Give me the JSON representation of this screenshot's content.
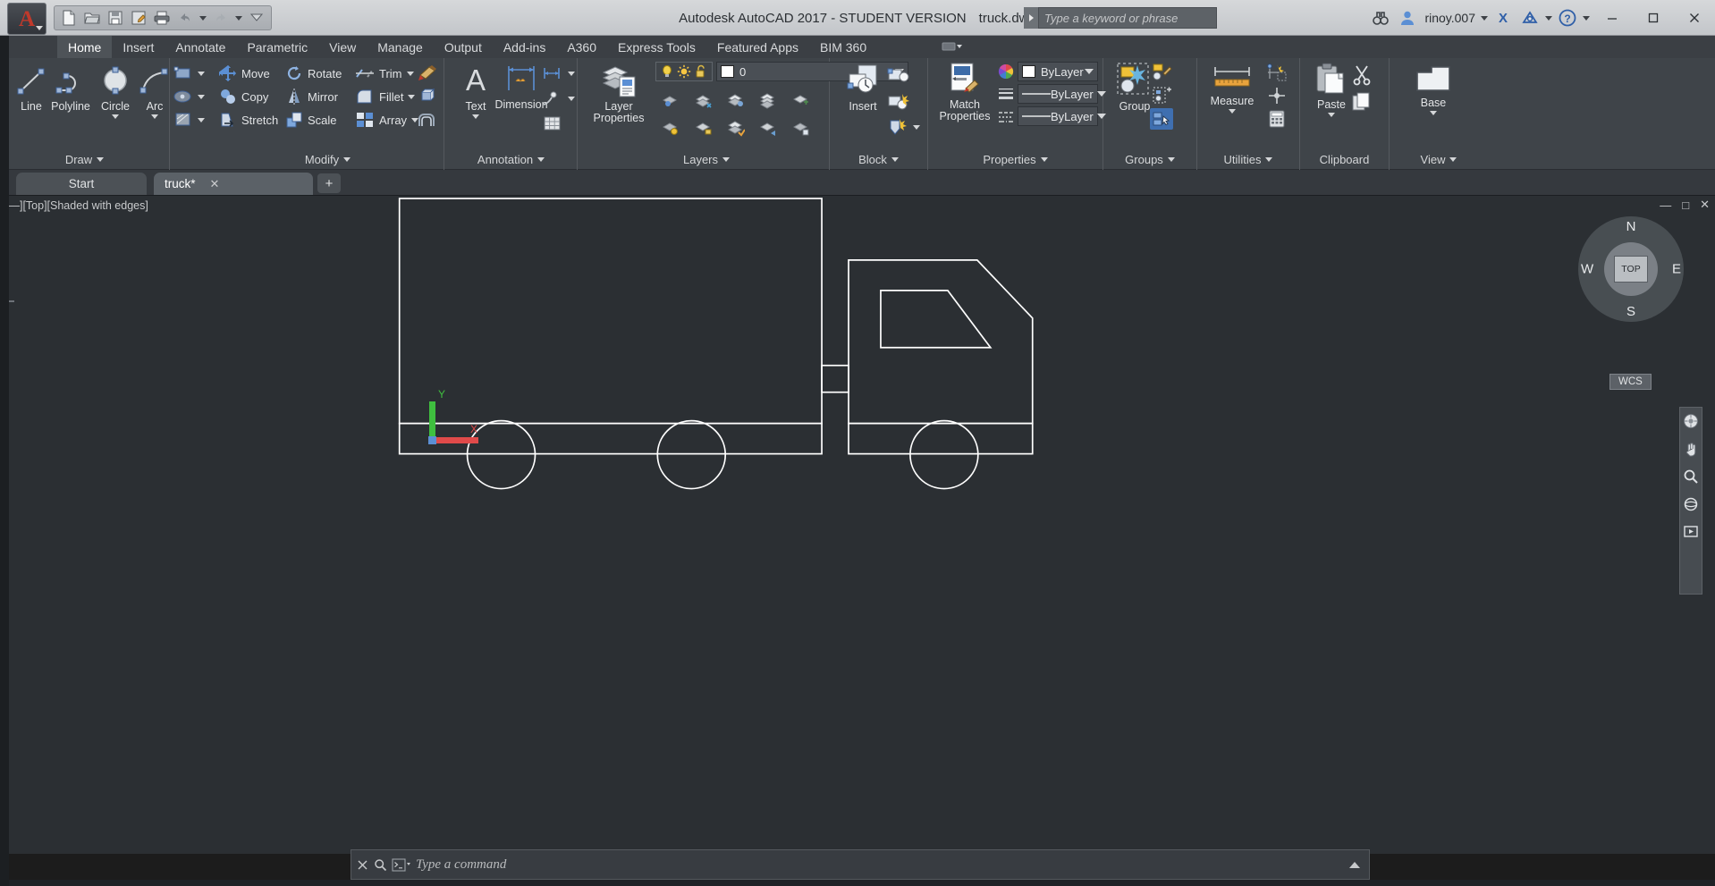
{
  "titlebar": {
    "app_name": "Autodesk AutoCAD 2017 - STUDENT VERSION",
    "file_name": "truck.dwg",
    "app_letter": "A",
    "quick_access": [
      {
        "name": "new-icon",
        "label": "New"
      },
      {
        "name": "open-icon",
        "label": "Open"
      },
      {
        "name": "save-icon",
        "label": "Save"
      },
      {
        "name": "saveas-icon",
        "label": "Save As"
      },
      {
        "name": "plot-icon",
        "label": "Plot"
      },
      {
        "name": "undo-icon",
        "label": "Undo"
      },
      {
        "name": "redo-icon",
        "label": "Redo"
      },
      {
        "name": "customize-icon",
        "label": "Customize Quick Access Toolbar"
      }
    ],
    "search_placeholder": "Type a keyword or phrase",
    "search_value": "",
    "user_name": "rinoy.007",
    "minimize": "—",
    "maximize": "□",
    "close": "✕",
    "help": "?"
  },
  "ribbon_tabs": [
    {
      "label": "Home",
      "active": true
    },
    {
      "label": "Insert",
      "active": false
    },
    {
      "label": "Annotate",
      "active": false
    },
    {
      "label": "Parametric",
      "active": false
    },
    {
      "label": "View",
      "active": false
    },
    {
      "label": "Manage",
      "active": false
    },
    {
      "label": "Output",
      "active": false
    },
    {
      "label": "Add-ins",
      "active": false
    },
    {
      "label": "A360",
      "active": false
    },
    {
      "label": "Express Tools",
      "active": false
    },
    {
      "label": "Featured Apps",
      "active": false
    },
    {
      "label": "BIM 360",
      "active": false
    }
  ],
  "panels": {
    "draw": {
      "title": "Draw",
      "buttons": [
        {
          "label": "Line",
          "icon": "line-icon"
        },
        {
          "label": "Polyline",
          "icon": "polyline-icon"
        },
        {
          "label": "Circle",
          "icon": "circle-icon"
        },
        {
          "label": "Arc",
          "icon": "arc-icon"
        }
      ],
      "flyouts": [
        {
          "icon": "rectangle-icon"
        },
        {
          "icon": "ellipse-icon"
        },
        {
          "icon": "hatch-icon"
        }
      ]
    },
    "modify": {
      "title": "Modify",
      "col1": [
        {
          "label": "Move",
          "icon": "move-icon"
        },
        {
          "label": "Copy",
          "icon": "copy-icon"
        },
        {
          "label": "Stretch",
          "icon": "stretch-icon"
        }
      ],
      "col2": [
        {
          "label": "Rotate",
          "icon": "rotate-icon"
        },
        {
          "label": "Mirror",
          "icon": "mirror-icon"
        },
        {
          "label": "Scale",
          "icon": "scale-icon"
        }
      ],
      "col3": [
        {
          "label": "Trim",
          "icon": "trim-icon"
        },
        {
          "label": "Fillet",
          "icon": "fillet-icon"
        },
        {
          "label": "Array",
          "icon": "array-icon"
        }
      ],
      "col4": [
        {
          "icon": "erase-icon"
        },
        {
          "icon": "explode-icon"
        },
        {
          "icon": "offset-icon"
        }
      ]
    },
    "annotation": {
      "title": "Annotation",
      "buttons": [
        {
          "label": "Text",
          "icon": "text-icon"
        },
        {
          "label": "Dimension",
          "icon": "dimension-icon"
        }
      ],
      "flyouts": [
        {
          "icon": "linear-dimension-icon"
        },
        {
          "icon": "leader-icon"
        },
        {
          "icon": "table-icon"
        }
      ]
    },
    "layers": {
      "title": "Layers",
      "layer_properties_label": "Layer Properties",
      "current_layer": "0",
      "layer_color": "#ffffff",
      "state_icons": [
        {
          "icon": "lightbulb-icon"
        },
        {
          "icon": "sun-icon"
        },
        {
          "icon": "unlock-icon"
        }
      ],
      "tool_icons": [
        {
          "icon": "layer-isolate-icon"
        },
        {
          "icon": "layer-freeze-icon"
        },
        {
          "icon": "layer-off-icon"
        },
        {
          "icon": "layer-unisolate-icon"
        },
        {
          "icon": "layer-lock-icon"
        },
        {
          "icon": "layer-merge-icon"
        },
        {
          "icon": "layer-make-current-icon"
        },
        {
          "icon": "layer-unlock-icon"
        },
        {
          "icon": "layer-match-icon"
        }
      ]
    },
    "block": {
      "title": "Block",
      "insert_label": "Insert",
      "tool_icons": [
        {
          "icon": "create-block-icon"
        },
        {
          "icon": "edit-block-icon"
        },
        {
          "icon": "define-attributes-icon"
        }
      ]
    },
    "properties": {
      "title": "Properties",
      "match_properties_label": "Match Properties",
      "color_value": "ByLayer",
      "linetype_value": "ByLayer",
      "lineweight_value": "ByLayer",
      "color_swatch": "#ffffff",
      "side_icons": [
        {
          "icon": "color-wheel-icon"
        },
        {
          "icon": "lineweight-icon"
        },
        {
          "icon": "linetype-icon"
        }
      ]
    },
    "groups": {
      "title": "Groups",
      "group_label": "Group",
      "tool_icons": [
        {
          "icon": "ungroup-icon"
        },
        {
          "icon": "group-edit-icon"
        },
        {
          "icon": "group-selection-on-icon"
        }
      ]
    },
    "utilities": {
      "title": "Utilities",
      "measure_label": "Measure",
      "tool_icons": [
        {
          "icon": "quick-select-icon"
        },
        {
          "icon": "point-style-icon"
        },
        {
          "icon": "calculator-icon"
        }
      ]
    },
    "clipboard": {
      "title": "Clipboard",
      "paste_label": "Paste",
      "tool_icons": [
        {
          "icon": "cut-icon"
        },
        {
          "icon": "copy-clip-icon"
        }
      ]
    },
    "view": {
      "title": "View",
      "base_label": "Base"
    }
  },
  "drawing_tabs": {
    "start_label": "Start",
    "file_label": "truck*",
    "close_glyph": "✕",
    "add_glyph": "+"
  },
  "viewport": {
    "label": "[—][Top][Shaded with edges]",
    "controls": [
      "—",
      "□",
      "✕"
    ],
    "background": "#2b2f33",
    "line_color": "#ffffff"
  },
  "viewcube": {
    "north": "N",
    "east": "E",
    "south": "S",
    "west": "W",
    "face": "TOP",
    "wcs": "WCS"
  },
  "navbar": {
    "icons": [
      {
        "icon": "steering-wheel-icon"
      },
      {
        "icon": "pan-icon"
      },
      {
        "icon": "zoom-icon"
      },
      {
        "icon": "orbit-icon"
      },
      {
        "icon": "showmotion-icon"
      }
    ]
  },
  "command_line": {
    "placeholder": "Type a command",
    "value": "",
    "close_glyph": "✕",
    "search_glyph": "🔍",
    "prompt_glyph": ">_"
  },
  "ucs_icon": {
    "x_label": "X",
    "y_label": "Y",
    "x_color": "#e04a4a",
    "y_color": "#4ad04a"
  }
}
